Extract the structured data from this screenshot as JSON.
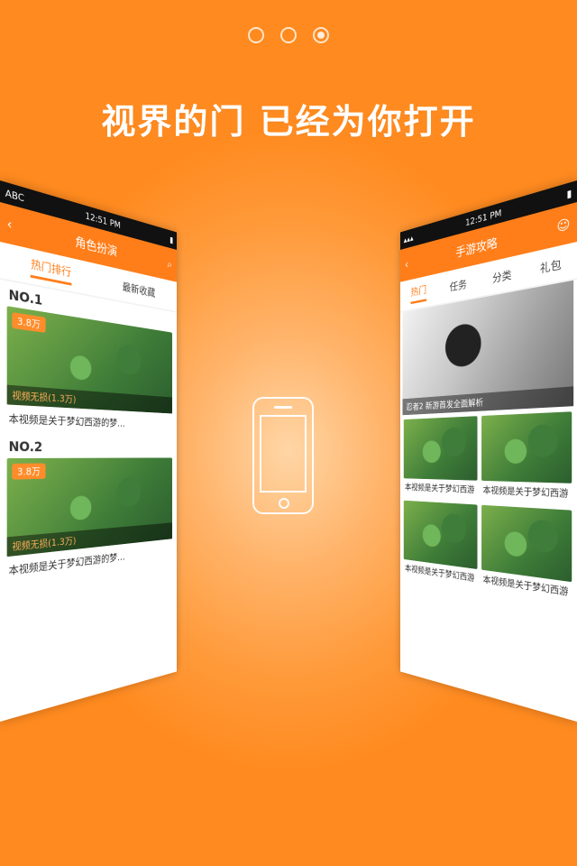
{
  "pager": {
    "count": 3,
    "active_index": 2
  },
  "headline": "视界的门 已经为你打开",
  "left_screen": {
    "status_left": "ABC",
    "status_time": "12:51 PM",
    "title": "角色扮演",
    "tabs": [
      "热门排行",
      "最新收藏"
    ],
    "items": [
      {
        "rank": "NO.1",
        "score": "3.8万",
        "caption": "视频无损(1.3万)",
        "desc": "本视频是关于梦幻西游的梦..."
      },
      {
        "rank": "NO.2",
        "score": "3.8万",
        "caption": "视频无损(1.3万)",
        "desc": "本视频是关于梦幻西游的梦..."
      }
    ]
  },
  "right_screen": {
    "status_time": "12:51 PM",
    "title": "手游攻略",
    "tabs": [
      "热门",
      "任务",
      "分类",
      "礼包"
    ],
    "banner_caption": "忍者2  新游首发全面解析",
    "cards": [
      {
        "desc": "本视频是关于梦幻西游"
      },
      {
        "desc": "本视频是关于梦幻西游"
      },
      {
        "desc": "本视频是关于梦幻西游"
      },
      {
        "desc": "本视频是关于梦幻西游"
      }
    ]
  }
}
